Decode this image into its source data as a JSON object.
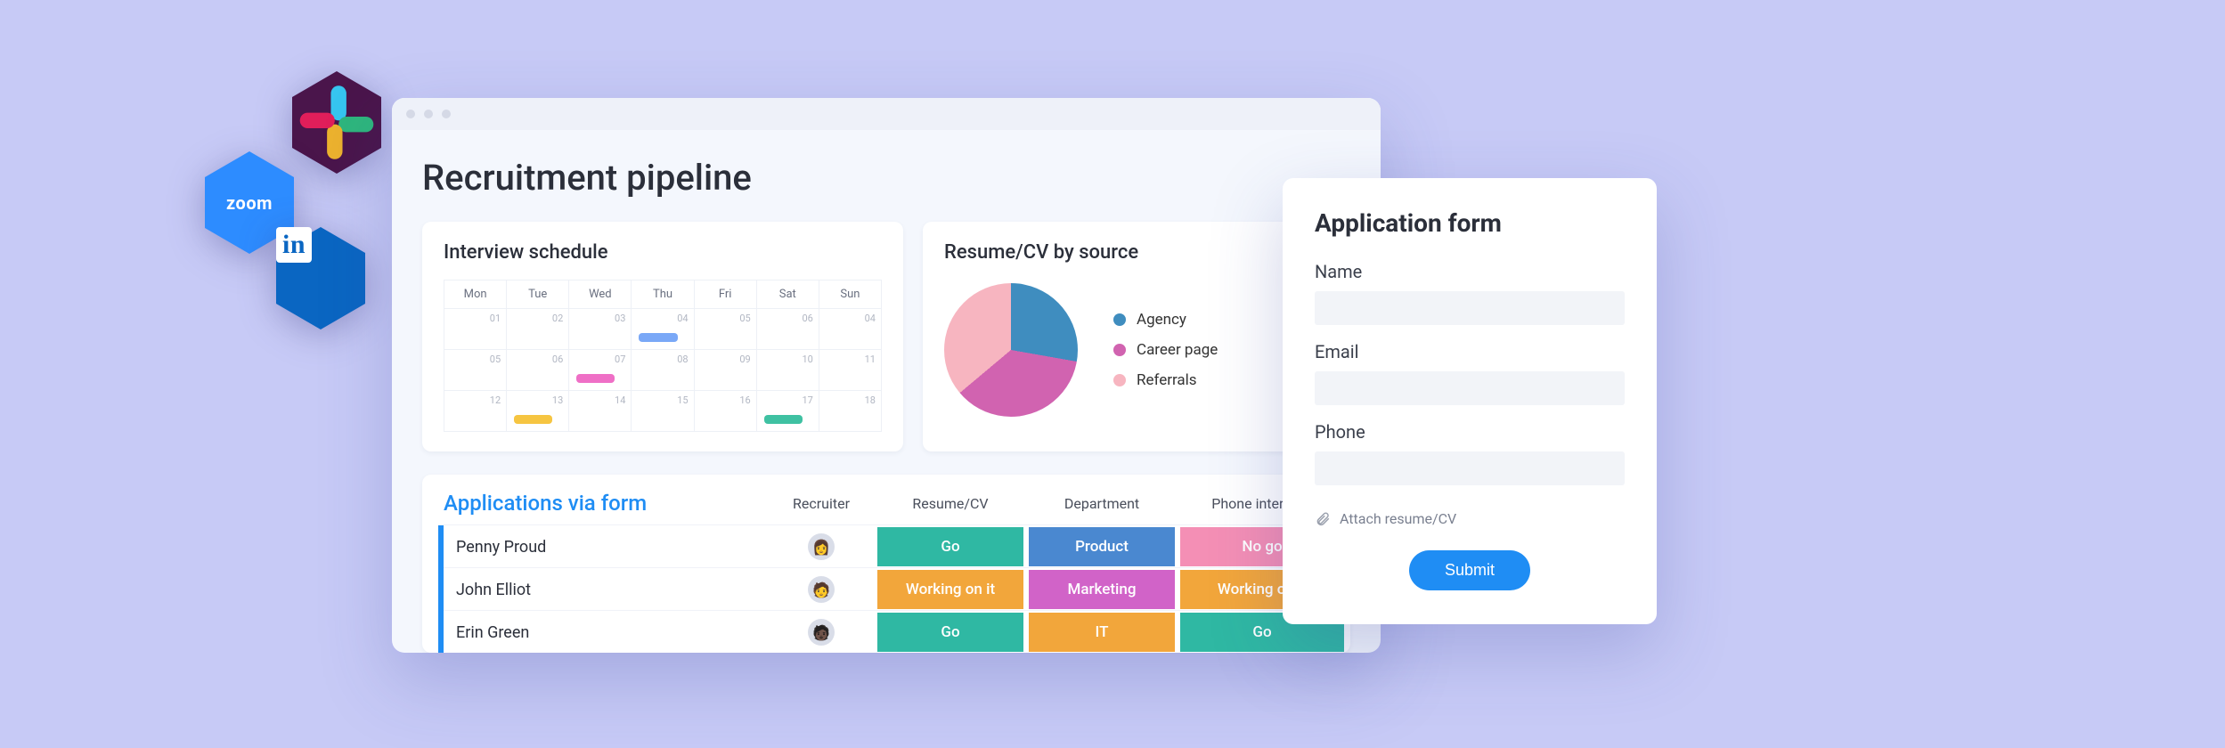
{
  "integrations": {
    "slack": {
      "name": "slack",
      "bg": "#4a154b"
    },
    "zoom": {
      "name": "zoom",
      "bg": "#2d8cff",
      "label": "zoom"
    },
    "linkedin": {
      "name": "linkedin",
      "bg": "#0a66c2",
      "label": "in"
    }
  },
  "page": {
    "title": "Recruitment pipeline"
  },
  "calendar": {
    "title": "Interview schedule",
    "days": [
      "Mon",
      "Tue",
      "Wed",
      "Thu",
      "Fri",
      "Sat",
      "Sun"
    ],
    "cells": [
      {
        "n": "01"
      },
      {
        "n": "02"
      },
      {
        "n": "03"
      },
      {
        "n": "04",
        "bar": "#7aa8f7"
      },
      {
        "n": "05"
      },
      {
        "n": "06"
      },
      {
        "n": "04"
      },
      {
        "n": "05"
      },
      {
        "n": "06"
      },
      {
        "n": "07",
        "bar": "#ef6fc6"
      },
      {
        "n": "08"
      },
      {
        "n": "09"
      },
      {
        "n": "10"
      },
      {
        "n": "11"
      },
      {
        "n": "12"
      },
      {
        "n": "13",
        "bar": "#f6c541"
      },
      {
        "n": "14"
      },
      {
        "n": "15"
      },
      {
        "n": "16"
      },
      {
        "n": "17",
        "bar": "#3fc1a2"
      },
      {
        "n": "18"
      }
    ]
  },
  "pie": {
    "title": "Resume/CV by source",
    "legend": [
      {
        "label": "Agency",
        "color": "#3f8dbf"
      },
      {
        "label": "Career page",
        "color": "#d163b0"
      },
      {
        "label": "Referrals",
        "color": "#f7b5c0"
      }
    ]
  },
  "chart_data": {
    "type": "pie",
    "title": "Resume/CV by source",
    "series": [
      {
        "name": "Agency",
        "value": 28,
        "color": "#3f8dbf"
      },
      {
        "name": "Career page",
        "value": 36,
        "color": "#d163b0"
      },
      {
        "name": "Referrals",
        "value": 36,
        "color": "#f7b5c0"
      }
    ]
  },
  "applications": {
    "title": "Applications via form",
    "columns": [
      "Recruiter",
      "Resume/CV",
      "Department",
      "Phone interview"
    ],
    "rows": [
      {
        "name": "Penny Proud",
        "avatar": "👩",
        "resume": {
          "t": "Go",
          "c": "#2fb8a3"
        },
        "dept": {
          "t": "Product",
          "c": "#4a88d0"
        },
        "phone": {
          "t": "No go",
          "c": "#f48fb5"
        }
      },
      {
        "name": "John Elliot",
        "avatar": "🧑",
        "resume": {
          "t": "Working on it",
          "c": "#f2a63b"
        },
        "dept": {
          "t": "Marketing",
          "c": "#d163c8"
        },
        "phone": {
          "t": "Working on it",
          "c": "#f2a63b"
        }
      },
      {
        "name": "Erin Green",
        "avatar": "🧑🏿",
        "resume": {
          "t": "Go",
          "c": "#2fb8a3"
        },
        "dept": {
          "t": "IT",
          "c": "#f2a63b"
        },
        "phone": {
          "t": "Go",
          "c": "#2fb8a3"
        }
      }
    ]
  },
  "form": {
    "title": "Application form",
    "fields": {
      "name": "Name",
      "email": "Email",
      "phone": "Phone"
    },
    "attach": "Attach resume/CV",
    "submit": "Submit"
  }
}
